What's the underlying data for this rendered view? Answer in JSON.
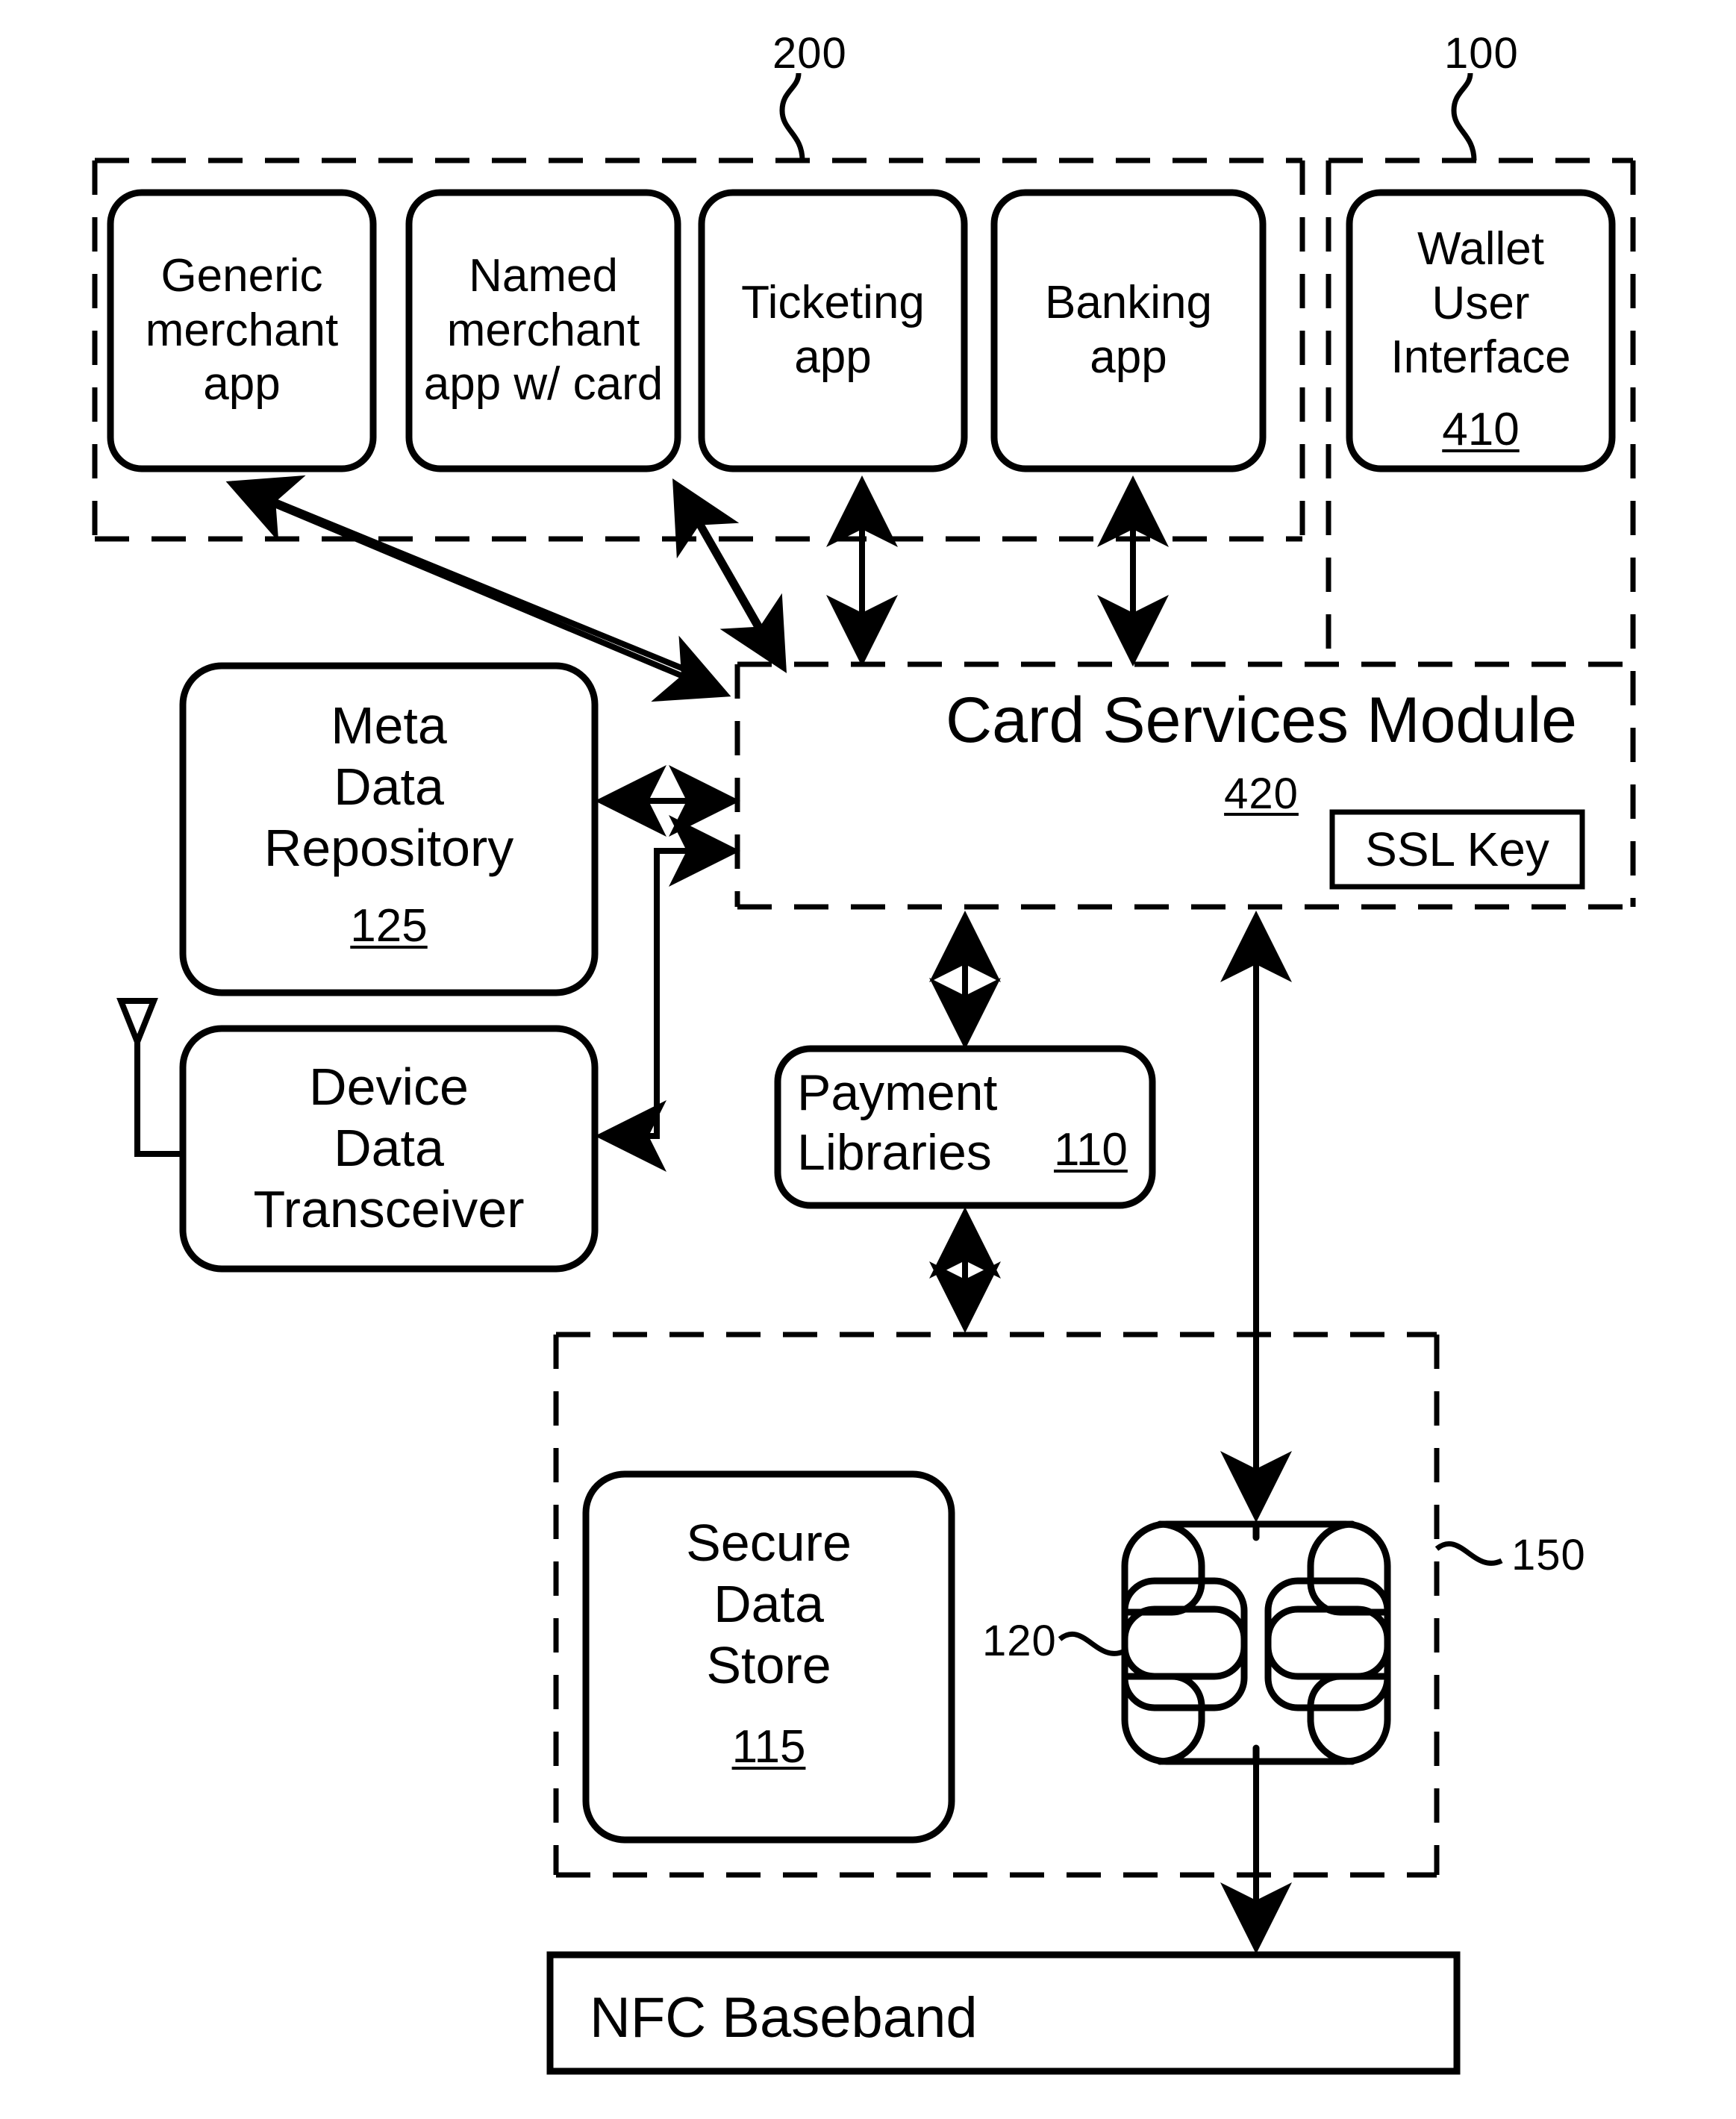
{
  "figure": {
    "type": "patent-block-diagram",
    "title": "Mobile payment card services architecture"
  },
  "regions": [
    {
      "id": "200",
      "name": "applications-region",
      "ref": "200"
    },
    {
      "id": "100",
      "name": "wallet-region",
      "ref": "100"
    },
    {
      "id": "150",
      "name": "secure-element-region",
      "ref": "150"
    }
  ],
  "apps": [
    {
      "label": "Generic\nmerchant\napp",
      "name": "generic-merchant-app"
    },
    {
      "label": "Named\nmerchant\napp w/ card",
      "name": "named-merchant-app"
    },
    {
      "label": "Ticketing\napp",
      "name": "ticketing-app"
    },
    {
      "label": "Banking\napp",
      "name": "banking-app"
    }
  ],
  "wallet": {
    "label": "Wallet\nUser\nInterface",
    "ref": "410"
  },
  "card_services": {
    "label": "Card Services Module",
    "ref": "420",
    "ssl_key_label": "SSL Key"
  },
  "meta_data_repository": {
    "label": "Meta\nData\nRepository",
    "ref": "125"
  },
  "device_data_transceiver": {
    "label": "Device\nData\nTransceiver"
  },
  "payment_libraries": {
    "label": "Payment\nLibraries",
    "ref": "110"
  },
  "secure_data_store": {
    "label": "Secure\nData\nStore",
    "ref": "115"
  },
  "chip": {
    "ref": "120",
    "name": "secure-element-chip"
  },
  "secure_element_region": {
    "ref": "150"
  },
  "nfc_baseband": {
    "label": "NFC Baseband"
  },
  "colors": {
    "stroke": "#000000",
    "background": "#ffffff"
  }
}
